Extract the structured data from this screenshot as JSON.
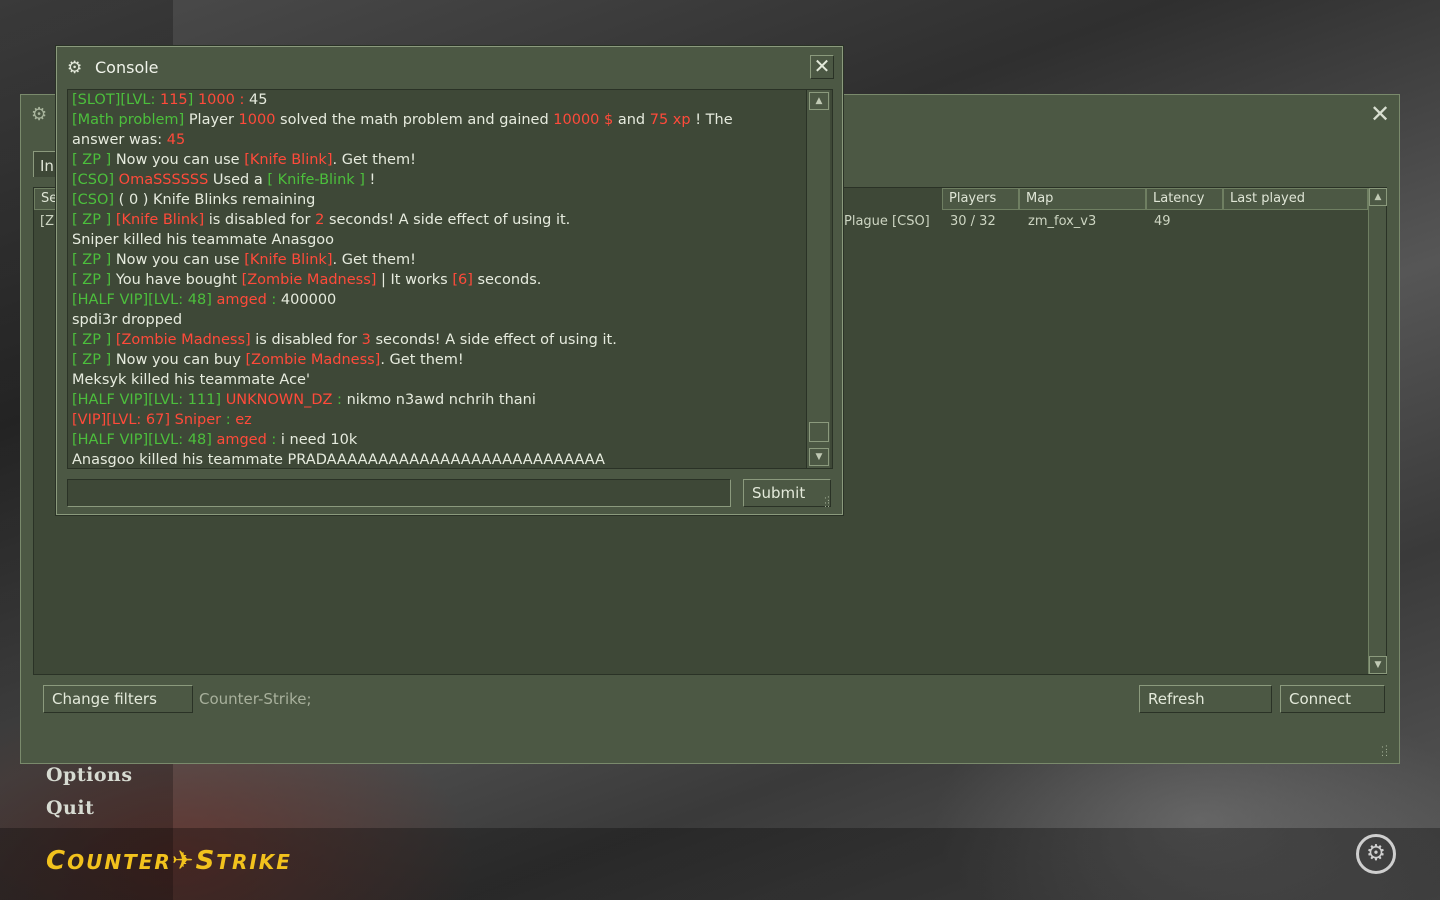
{
  "colors": {
    "panel": "#4c5844",
    "panel_dark": "#3e4837",
    "highlight_green": "#4cbf3c",
    "highlight_red": "#ff4a3a",
    "logo_yellow": "#f2c21d"
  },
  "icons": {
    "console_logo": "cs-steam-logo-icon",
    "close": "close-icon",
    "scroll_up": "chevron-up-icon",
    "scroll_down": "chevron-down-icon"
  },
  "server_browser": {
    "tab_label": "In",
    "columns": [
      "Se",
      "Players",
      "Map",
      "Latency",
      "Last played"
    ],
    "rows": [
      {
        "name_left": "[Z",
        "name_right": "Plague [CSO]",
        "players": "30 / 32",
        "map": "zm_fox_v3",
        "latency": "49",
        "last_played": ""
      }
    ],
    "change_filters_label": "Change filters",
    "filter_text": "Counter-Strike;",
    "refresh_label": "Refresh",
    "connect_label": "Connect"
  },
  "console": {
    "title": "Console",
    "submit_label": "Submit",
    "input_value": "",
    "lines": [
      [
        {
          "t": "[SLOT][LVL: ",
          "c": "hl"
        },
        {
          "t": "115",
          "c": "rd"
        },
        {
          "t": "] ",
          "c": "hl"
        },
        {
          "t": "1000 : ",
          "c": "rd"
        },
        {
          "t": "45",
          "c": ""
        }
      ],
      [
        {
          "t": "[Math problem] ",
          "c": "hl"
        },
        {
          "t": "Player ",
          "c": ""
        },
        {
          "t": "1000",
          "c": "rd"
        },
        {
          "t": " solved the math problem and gained ",
          "c": ""
        },
        {
          "t": "10000 $",
          "c": "rd"
        },
        {
          "t": " and ",
          "c": ""
        },
        {
          "t": "75 xp",
          "c": "rd"
        },
        {
          "t": " ! The",
          "c": ""
        }
      ],
      [
        {
          "t": "answer was: ",
          "c": ""
        },
        {
          "t": "45",
          "c": "rd"
        }
      ],
      [
        {
          "t": "[ ZP ] ",
          "c": "hl"
        },
        {
          "t": "Now you can use ",
          "c": ""
        },
        {
          "t": "[Knife Blink]",
          "c": "rd"
        },
        {
          "t": ". Get them!",
          "c": ""
        }
      ],
      [
        {
          "t": "[CSO] ",
          "c": "hl"
        },
        {
          "t": "OmaSSSSSS",
          "c": "rd"
        },
        {
          "t": " Used a ",
          "c": ""
        },
        {
          "t": "[ Knife-Blink ]",
          "c": "hl"
        },
        {
          "t": " !",
          "c": ""
        }
      ],
      [
        {
          "t": "[CSO] ",
          "c": "hl"
        },
        {
          "t": "( 0 ) Knife Blinks remaining",
          "c": ""
        }
      ],
      [
        {
          "t": "[ ZP ] ",
          "c": "hl"
        },
        {
          "t": "[Knife Blink]",
          "c": "rd"
        },
        {
          "t": " is disabled for ",
          "c": ""
        },
        {
          "t": "2",
          "c": "rd"
        },
        {
          "t": " seconds! A side effect of using it.",
          "c": ""
        }
      ],
      [
        {
          "t": "Sniper killed his teammate Anasgoo",
          "c": ""
        }
      ],
      [
        {
          "t": "[ ZP ] ",
          "c": "hl"
        },
        {
          "t": "Now you can use ",
          "c": ""
        },
        {
          "t": "[Knife Blink]",
          "c": "rd"
        },
        {
          "t": ". Get them!",
          "c": ""
        }
      ],
      [
        {
          "t": "[ ZP ] ",
          "c": "hl"
        },
        {
          "t": "You have bought ",
          "c": ""
        },
        {
          "t": "[Zombie Madness]",
          "c": "rd"
        },
        {
          "t": " | It works ",
          "c": ""
        },
        {
          "t": "[6]",
          "c": "rd"
        },
        {
          "t": " seconds.",
          "c": ""
        }
      ],
      [
        {
          "t": "[HALF VIP][LVL: 48] ",
          "c": "hl"
        },
        {
          "t": "amged",
          "c": "rd"
        },
        {
          "t": " : ",
          "c": "hl"
        },
        {
          "t": "400000",
          "c": ""
        }
      ],
      [
        {
          "t": "spdi3r dropped",
          "c": ""
        }
      ],
      [
        {
          "t": "[ ZP ] ",
          "c": "hl"
        },
        {
          "t": "[Zombie Madness]",
          "c": "rd"
        },
        {
          "t": " is disabled for ",
          "c": ""
        },
        {
          "t": "3",
          "c": "rd"
        },
        {
          "t": " seconds! A side effect of using it.",
          "c": ""
        }
      ],
      [
        {
          "t": "[ ZP ] ",
          "c": "hl"
        },
        {
          "t": "Now you can buy ",
          "c": ""
        },
        {
          "t": "[Zombie Madness]",
          "c": "rd"
        },
        {
          "t": ". Get them!",
          "c": ""
        }
      ],
      [
        {
          "t": "Meksyk killed his teammate Ace'",
          "c": ""
        }
      ],
      [
        {
          "t": "[HALF VIP][LVL: 111] ",
          "c": "hl"
        },
        {
          "t": "UNKNOWN_DZ",
          "c": "rd"
        },
        {
          "t": " : ",
          "c": "hl"
        },
        {
          "t": "nikmo n3awd nchrih thani",
          "c": ""
        }
      ],
      [
        {
          "t": "[VIP][LVL: 67] ",
          "c": "rd"
        },
        {
          "t": "Sniper",
          "c": "rd"
        },
        {
          "t": " : ",
          "c": "hl"
        },
        {
          "t": "ez",
          "c": "rd"
        }
      ],
      [
        {
          "t": "[HALF VIP][LVL: 48] ",
          "c": "hl"
        },
        {
          "t": "amged",
          "c": "rd"
        },
        {
          "t": " : ",
          "c": "hl"
        },
        {
          "t": "i need 10k",
          "c": ""
        }
      ],
      [
        {
          "t": "Anasgoo killed his teammate PRADAAAAAAAAAAAAAAAAAAAAAAAAAAA",
          "c": ""
        }
      ]
    ]
  },
  "main_menu": {
    "items": [
      "Options",
      "Quit"
    ],
    "logo_text": "COUNTER-STRIKE"
  }
}
